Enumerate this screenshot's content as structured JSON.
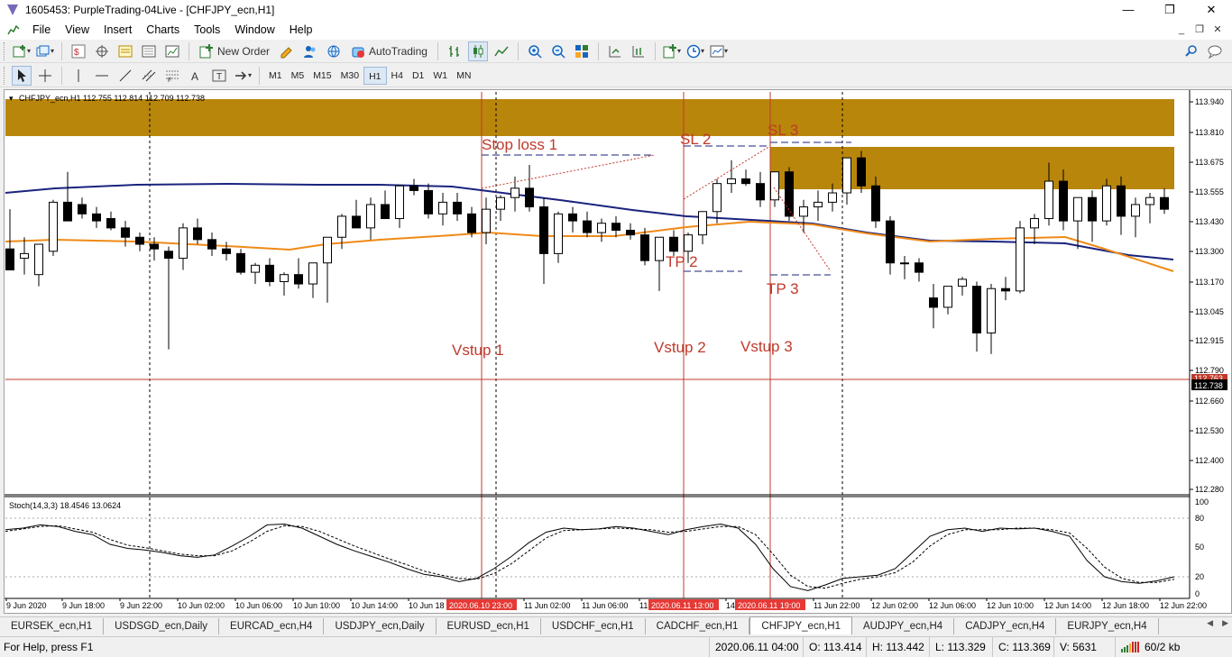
{
  "window": {
    "title": "1605453: PurpleTrading-04Live - [CHFJPY_ecn,H1]",
    "minimize": "—",
    "maximize": "❐",
    "close": "✕"
  },
  "menu": {
    "items": [
      "File",
      "View",
      "Insert",
      "Charts",
      "Tools",
      "Window",
      "Help"
    ],
    "mdi_buttons": [
      "_",
      "❐",
      "✕"
    ]
  },
  "toolbar": {
    "new_order_label": "New Order",
    "autotrading_label": "AutoTrading"
  },
  "timeframes": [
    "M1",
    "M5",
    "M15",
    "M30",
    "H1",
    "H4",
    "D1",
    "W1",
    "MN"
  ],
  "active_timeframe": "H1",
  "chart": {
    "header": "CHFJPY_ecn,H1  112.755 112.814 112.709 112.738",
    "stoch_header": "Stoch(14,3,3) 18.4546 13.0624",
    "bid_label": "112.763",
    "current_label": "112.738",
    "price_axis": [
      "113.940",
      "113.810",
      "113.675",
      "113.555",
      "113.430",
      "113.300",
      "113.170",
      "113.045",
      "112.915",
      "112.790",
      "112.660",
      "112.530",
      "112.400",
      "112.280"
    ],
    "stoch_axis": [
      "100",
      "80",
      "50",
      "20",
      "0"
    ],
    "time_axis": [
      "9 Jun 2020",
      "9 Jun 18:00",
      "9 Jun 22:00",
      "10 Jun 02:00",
      "10 Jun 06:00",
      "10 Jun 10:00",
      "10 Jun 14:00",
      "10 Jun 18",
      "11 Jun 02:00",
      "11 Jun 06:00",
      "11",
      "14",
      "11 Jun 22:00",
      "12 Jun 02:00",
      "12 Jun 06:00",
      "12 Jun 10:00",
      "12 Jun 14:00",
      "12 Jun 18:00",
      "12 Jun 22:00"
    ],
    "highlight_times": [
      "2020.06.10 23:00",
      "2020.06.11 13:00",
      "2020.06.11 19:00"
    ],
    "annotations": [
      "Stop loss 1",
      "SL 2",
      "SL 3",
      "TP 2",
      "TP 3",
      "Vstup 1",
      "Vstup 2",
      "Vstup 3"
    ],
    "colors": {
      "zone": "#b8860b",
      "annotation": "#c0392b",
      "ma_slow": "#1a237e",
      "ma_fast": "#ef8a17",
      "bid_line": "#c0392b"
    }
  },
  "tabs": [
    "EURSEK_ecn,H1",
    "USDSGD_ecn,Daily",
    "EURCAD_ecn,H4",
    "USDJPY_ecn,Daily",
    "EURUSD_ecn,H1",
    "USDCHF_ecn,H1",
    "CADCHF_ecn,H1",
    "CHFJPY_ecn,H1",
    "AUDJPY_ecn,H4",
    "CADJPY_ecn,H4",
    "EURJPY_ecn,H4"
  ],
  "active_tab": "CHFJPY_ecn,H1",
  "status": {
    "help": "For Help, press F1",
    "datetime": "2020.06.11 04:00",
    "open": "O: 113.414",
    "high": "H: 113.442",
    "low": "L: 113.329",
    "close": "C: 113.369",
    "volume": "V: 5631",
    "traffic": "60/2 kb"
  }
}
